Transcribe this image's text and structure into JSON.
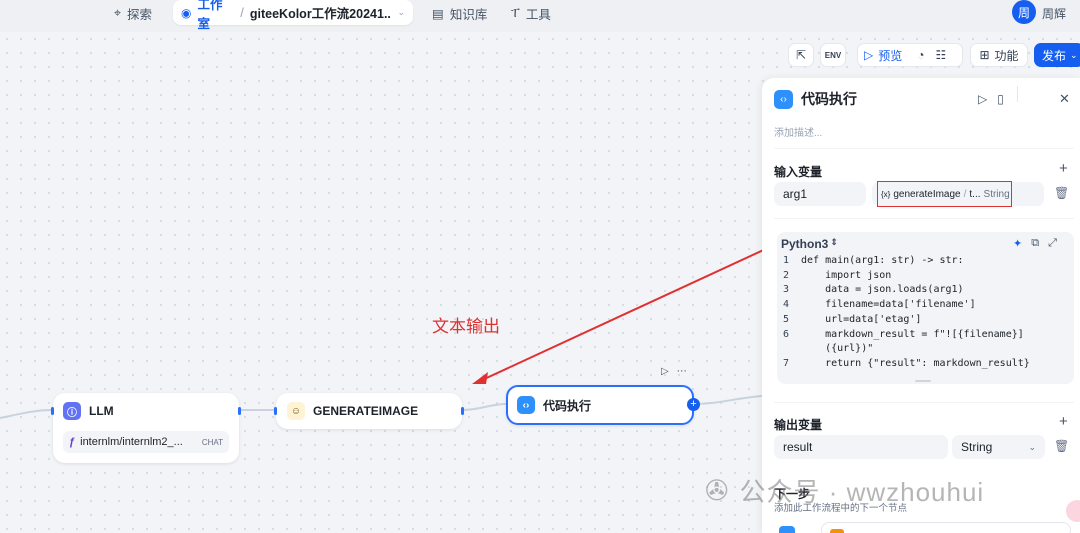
{
  "nav": {
    "explore": "探索",
    "studio": "工作室",
    "workflow_name": "giteeKolor工作流20241...",
    "knowledge": "知识库",
    "tools": "工具",
    "avatar_initial": "周",
    "username": "周辉"
  },
  "toolbar": {
    "preview": "预览",
    "features": "功能",
    "publish": "发布"
  },
  "nodes": {
    "llm": {
      "title": "LLM",
      "model": "internlm/internlm2_...",
      "mode": "CHAT"
    },
    "generate": {
      "title": "GENERATEIMAGE"
    },
    "code": {
      "title": "代码执行"
    }
  },
  "annotation": "文本输出",
  "panel": {
    "title": "代码执行",
    "desc_placeholder": "添加描述...",
    "input_vars_title": "输入变量",
    "input_var_name": "arg1",
    "input_var_source": "generateImage",
    "input_var_sep": "/",
    "input_var_field": "t...",
    "input_var_type": "String",
    "language": "Python3",
    "output_vars_title": "输出变量",
    "output_var_name": "result",
    "output_var_type": "String",
    "next_step_title": "下一步",
    "next_step_desc": "添加此工作流程中的下一个节点"
  },
  "code_lines": [
    {
      "n": "1",
      "text": "def main(arg1: str) -> str:"
    },
    {
      "n": "2",
      "text": "    import json"
    },
    {
      "n": "3",
      "text": "    data = json.loads(arg1)"
    },
    {
      "n": "4",
      "text": "    filename=data['filename']"
    },
    {
      "n": "5",
      "text": "    url=data['etag']"
    },
    {
      "n": "6",
      "text": "    markdown_result = f\"![{filename}]"
    },
    {
      "n": "",
      "text": "    ({url})\""
    },
    {
      "n": "7",
      "text": "    return {\"result\": markdown_result}"
    }
  ],
  "watermark": "公众号 · wwzhouhui",
  "colors": {
    "accent": "#155eef",
    "annotation": "#e03131"
  }
}
